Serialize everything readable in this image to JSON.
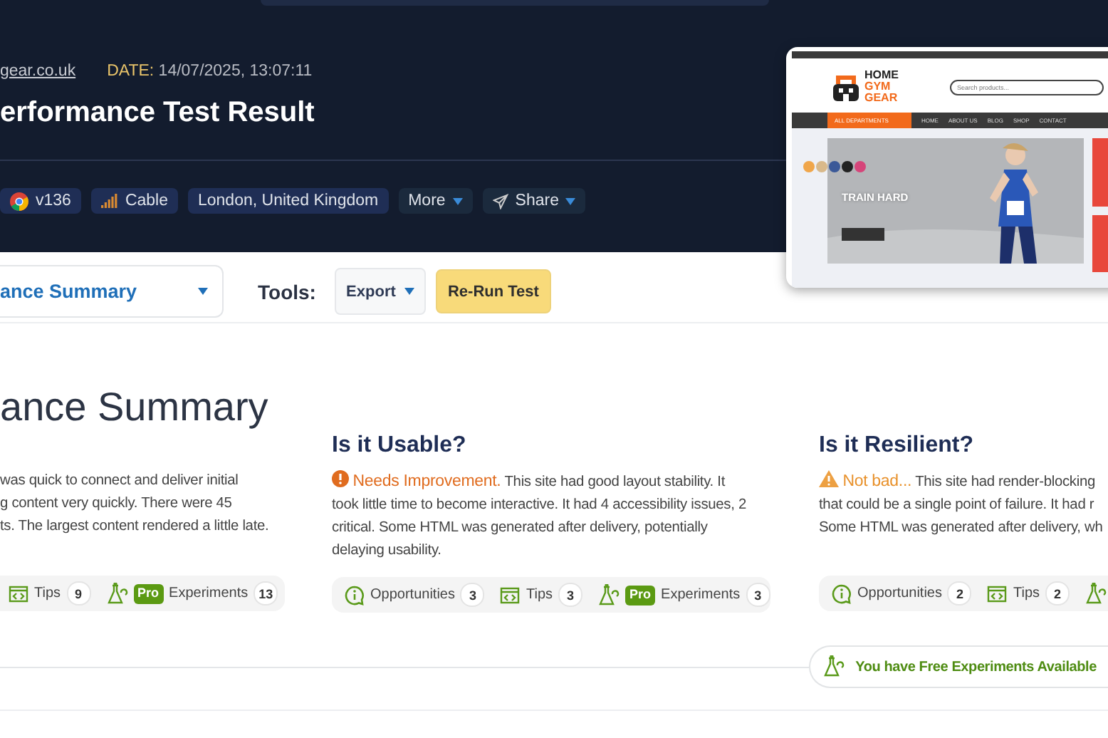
{
  "header": {
    "site_link": "gear.co.uk",
    "date_label": "DATE:",
    "date_value": "14/07/2025, 13:07:11",
    "title": "erformance Test Result",
    "chips": [
      {
        "kind": "browser",
        "label": "v136"
      },
      {
        "kind": "connection",
        "label": "Cable"
      },
      {
        "kind": "location",
        "label": "London, United Kingdom"
      },
      {
        "kind": "menu",
        "label": "More"
      },
      {
        "kind": "share",
        "label": "Share"
      }
    ]
  },
  "preview": {
    "logo": [
      "HOME",
      "GYM",
      "GEAR"
    ],
    "search_placeholder": "Search products...",
    "departments": "ALL DEPARTMENTS",
    "nav": [
      "HOME",
      "ABOUT US",
      "BLOG",
      "SHOP",
      "CONTACT"
    ],
    "hero_title": "TRAIN HARD"
  },
  "toolbar": {
    "view_select": "ance Summary",
    "tools_label": "Tools:",
    "export": "Export",
    "rerun": "Re-Run Test"
  },
  "summary": {
    "title": "ance Summary",
    "columns": [
      {
        "lines": [
          "was quick to connect and deliver initial",
          "g content very quickly. There were 45",
          "ts. The largest content rendered a little late."
        ],
        "counts": [
          {
            "kind": "tips",
            "label": "Tips",
            "count": "9"
          },
          {
            "kind": "experiments",
            "pro": "Pro",
            "label": "Experiments",
            "count": "13"
          }
        ]
      },
      {
        "heading": "Is it Usable?",
        "status": {
          "kind": "needs_improvement",
          "label": "Needs Improvement."
        },
        "lines": [
          "This site had good layout stability. It",
          "took little time to become interactive. It had 4 accessibility issues, 2",
          "critical. Some HTML was generated after delivery, potentially",
          "delaying usability."
        ],
        "counts": [
          {
            "kind": "opportunities",
            "label": "Opportunities",
            "count": "3"
          },
          {
            "kind": "tips",
            "label": "Tips",
            "count": "3"
          },
          {
            "kind": "experiments",
            "pro": "Pro",
            "label": "Experiments",
            "count": "3"
          }
        ]
      },
      {
        "heading": "Is it Resilient?",
        "status": {
          "kind": "not_bad",
          "label": "Not bad..."
        },
        "lines": [
          "This site had render-blocking",
          "that could be a single point of failure. It had r",
          "Some HTML was generated after delivery, wh"
        ],
        "counts": [
          {
            "kind": "opportunities",
            "label": "Opportunities",
            "count": "2"
          },
          {
            "kind": "tips",
            "label": "Tips",
            "count": "2"
          },
          {
            "kind": "experiments"
          }
        ]
      }
    ],
    "free_experiments": "You have Free Experiments Available"
  }
}
